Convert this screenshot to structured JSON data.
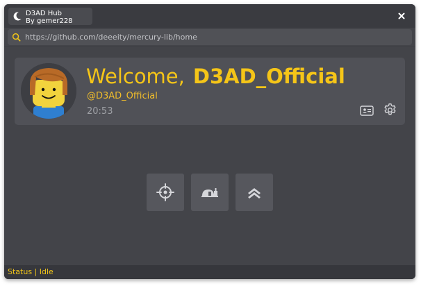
{
  "window": {
    "brand": {
      "title": "D3AD Hub",
      "subtitle": "By gemer228",
      "icon": "moon-icon"
    },
    "close_icon": "close-icon"
  },
  "urlbar": {
    "icon": "search-icon",
    "value": "https://github.com/deeeity/mercury-lib/home"
  },
  "profile": {
    "welcome_label": "Welcome,",
    "username": "D3AD_Official",
    "handle": "@D3AD_Official",
    "time": "20:53",
    "avatar": "avatar",
    "actions": [
      "id-card-icon",
      "gear-icon"
    ]
  },
  "action_buttons": [
    {
      "icon": "crosshair-icon"
    },
    {
      "icon": "teleport-icon"
    },
    {
      "icon": "chevrons-up-icon"
    }
  ],
  "status": {
    "text": "Status | Idle"
  },
  "colors": {
    "accent": "#f5c518",
    "window_bg": "#434449",
    "card_bg": "#505157",
    "titlebar_bg": "#3a3b40",
    "button_bg": "#56575d",
    "muted_text": "#9ea0a5"
  }
}
